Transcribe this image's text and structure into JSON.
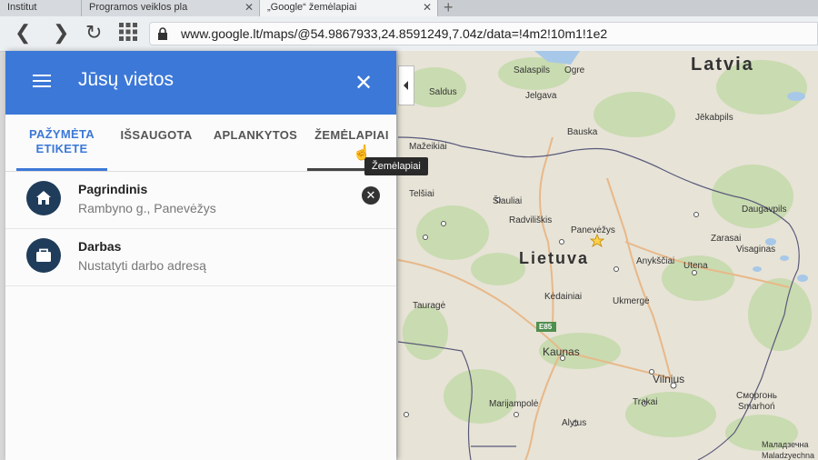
{
  "browser": {
    "tabs": [
      {
        "label": "Institut"
      },
      {
        "label": "Programos veiklos pla"
      },
      {
        "label": "„Google“ žemėlapiai"
      }
    ],
    "url": "www.google.lt/maps/@54.9867933,24.8591249,7.04z/data=!4m2!10m1!1e2"
  },
  "panel": {
    "title": "Jūsų vietos",
    "tabs": [
      {
        "label": "PAŽYMĖTA ETIKETE"
      },
      {
        "label": "IŠSAUGOTA"
      },
      {
        "label": "APLANKYTOS"
      },
      {
        "label": "ŽEMĖLAPIAI"
      }
    ],
    "tooltip": "Žemėlapiai",
    "places": [
      {
        "name": "Pagrindinis",
        "detail": "Rambyno g., Panevėžys",
        "icon": "home-icon"
      },
      {
        "name": "Darbas",
        "detail": "Nustatyti darbo adresą",
        "icon": "briefcase-icon"
      }
    ]
  },
  "map": {
    "countries": [
      "Latvia",
      "Lietuva"
    ],
    "cities": [
      "Salaspils",
      "Ogre",
      "Saldus",
      "Jelgava",
      "Jēkabpils",
      "Bauska",
      "Mažeikiai",
      "Telšiai",
      "Šiauliai",
      "Radviliškis",
      "Panevėžys",
      "Daugavpils",
      "Zarasai",
      "Visaginas",
      "Anykščiai",
      "Utena",
      "Tauragė",
      "Kėdainiai",
      "Ukmergė",
      "Kaunas",
      "Vilnius",
      "Marijampolė",
      "Trakai",
      "Alytus",
      "Сморгонь",
      "Smarhoń",
      "Маладзечна",
      "Maladzyechna"
    ],
    "road": "E85",
    "colors": {
      "land": "#e7e3d7",
      "forest": "#c9dbb0",
      "water": "#a7c8e8",
      "border": "#5a5a7a",
      "header": "#3c78d8"
    }
  }
}
